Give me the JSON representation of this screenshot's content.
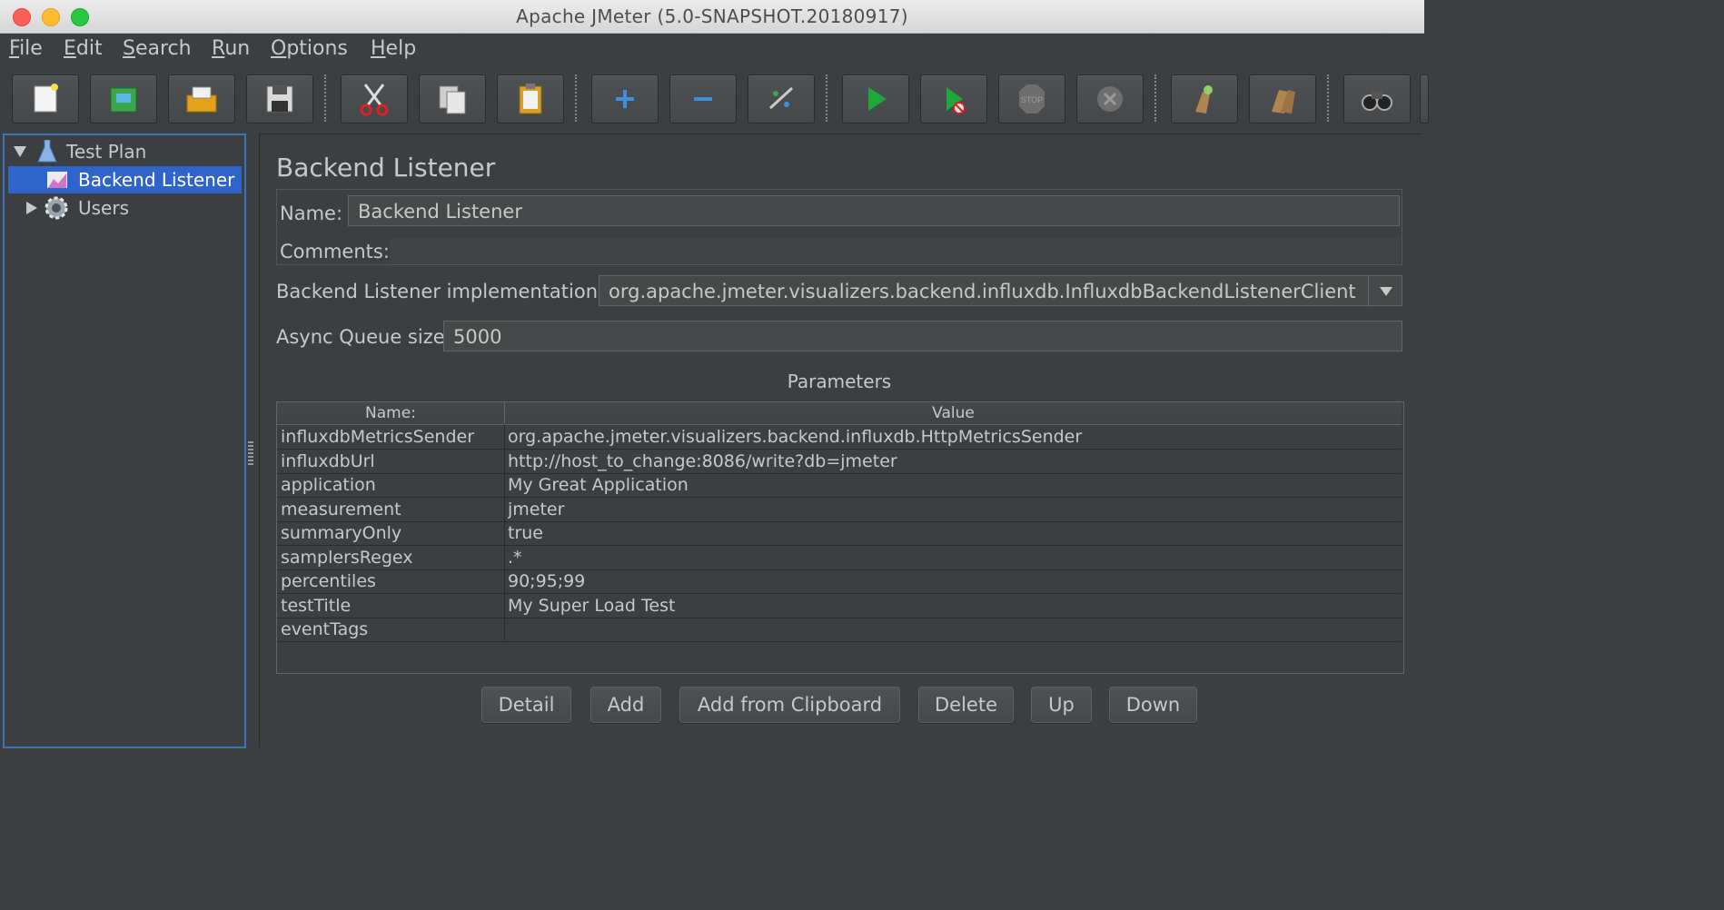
{
  "window": {
    "title": "Apache JMeter (5.0-SNAPSHOT.20180917)"
  },
  "menu": [
    {
      "mnemonic": "F",
      "rest": "ile"
    },
    {
      "mnemonic": "E",
      "rest": "dit"
    },
    {
      "mnemonic": "S",
      "rest": "earch"
    },
    {
      "mnemonic": "R",
      "rest": "un"
    },
    {
      "mnemonic": "O",
      "rest": "ptions"
    },
    {
      "mnemonic": "H",
      "rest": "elp"
    }
  ],
  "toolbar_icons": [
    "new-icon",
    "templates-icon",
    "open-icon",
    "save-icon",
    "cut-icon",
    "copy-icon",
    "paste-icon",
    "expand-icon",
    "collapse-icon",
    "toggle-icon",
    "start-icon",
    "start-no-pauses-icon",
    "stop-icon",
    "shutdown-icon",
    "clear-icon",
    "clear-all-icon",
    "search-icon"
  ],
  "tree": {
    "items": [
      {
        "label": "Test Plan",
        "icon": "test-plan-icon",
        "expanded": true
      },
      {
        "label": "Backend Listener",
        "icon": "backend-listener-icon",
        "selected": true
      },
      {
        "label": "Users",
        "icon": "thread-group-icon",
        "expanded": false
      }
    ]
  },
  "panel": {
    "title": "Backend Listener",
    "name_label": "Name:",
    "name_value": "Backend Listener",
    "comments_label": "Comments:",
    "comments_value": "",
    "impl_label": "Backend Listener implementation",
    "impl_value": "org.apache.jmeter.visualizers.backend.influxdb.InfluxdbBackendListenerClient",
    "queue_label": "Async Queue size",
    "queue_value": "5000",
    "params_title": "Parameters",
    "col_name": "Name:",
    "col_value": "Value",
    "rows": [
      {
        "name": "influxdbMetricsSender",
        "value": "org.apache.jmeter.visualizers.backend.influxdb.HttpMetricsSender"
      },
      {
        "name": "influxdbUrl",
        "value": "http://host_to_change:8086/write?db=jmeter"
      },
      {
        "name": "application",
        "value": "My Great Application"
      },
      {
        "name": "measurement",
        "value": "jmeter"
      },
      {
        "name": "summaryOnly",
        "value": "true"
      },
      {
        "name": "samplersRegex",
        "value": ".*"
      },
      {
        "name": "percentiles",
        "value": "90;95;99"
      },
      {
        "name": "testTitle",
        "value": "My Super Load Test"
      },
      {
        "name": "eventTags",
        "value": ""
      }
    ],
    "buttons": {
      "detail": "Detail",
      "add": "Add",
      "add_clipboard": "Add from Clipboard",
      "delete": "Delete",
      "up": "Up",
      "down": "Down"
    }
  },
  "colors": {
    "selection": "#2f65ca",
    "background": "#3c3f41",
    "text": "#c8c8c8"
  }
}
